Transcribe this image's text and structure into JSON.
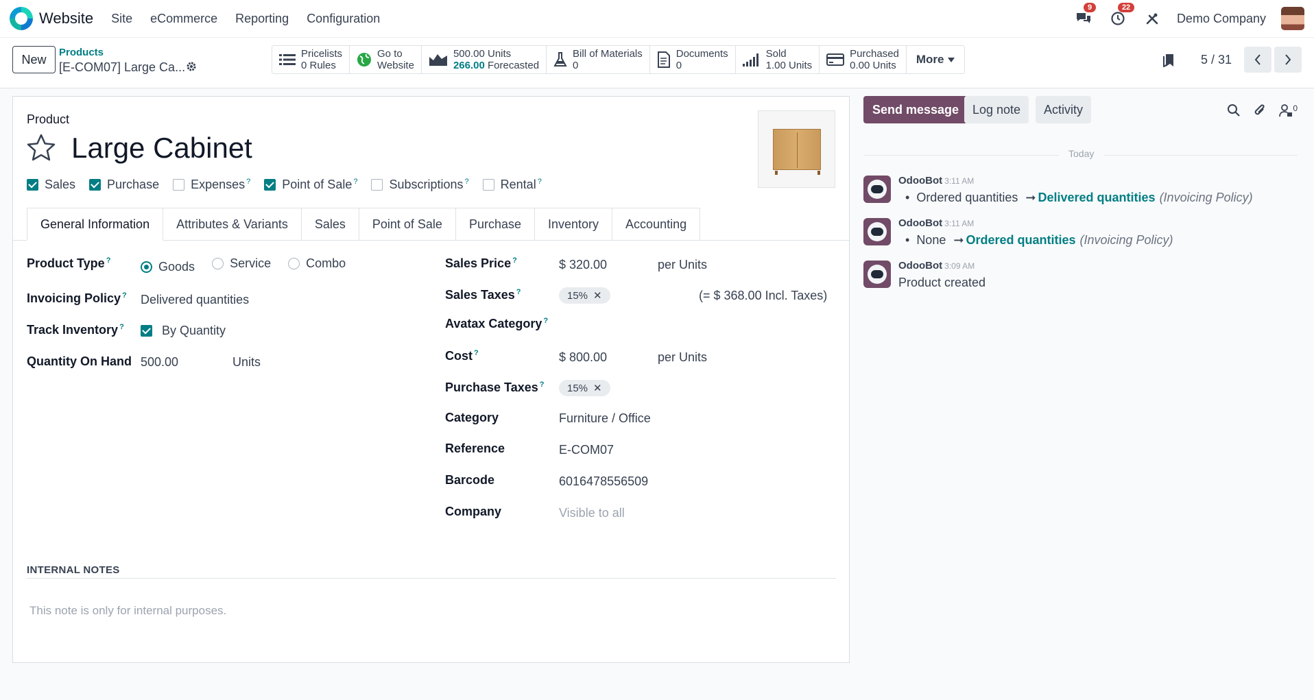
{
  "navbar": {
    "app_name": "Website",
    "menus": [
      "Site",
      "eCommerce",
      "Reporting",
      "Configuration"
    ],
    "messages_count": "9",
    "activities_count": "22",
    "company": "Demo Company"
  },
  "control": {
    "new_label": "New",
    "breadcrumb_parent": "Products",
    "breadcrumb_current": "[E-COM07] Large Ca...",
    "smart_buttons": [
      {
        "icon": "list-icon",
        "line1": "Pricelists",
        "line2": "0 Rules"
      },
      {
        "icon": "globe-icon",
        "line1": "Go to",
        "line2": "Website"
      },
      {
        "icon": "area-chart-icon",
        "line1": "500.00 Units",
        "line2_value": "266.00",
        "line2_suffix": "Forecasted"
      },
      {
        "icon": "flask-icon",
        "line1": "Bill of Materials",
        "line2": "0"
      },
      {
        "icon": "document-icon",
        "line1": "Documents",
        "line2": "0"
      },
      {
        "icon": "signal-bars-icon",
        "line1": "Sold",
        "line2": "1.00 Units"
      },
      {
        "icon": "credit-card-icon",
        "line1": "Purchased",
        "line2": "0.00 Units"
      }
    ],
    "more_label": "More",
    "pager": "5 / 31"
  },
  "product": {
    "section_label": "Product",
    "name": "Large Cabinet",
    "flags": [
      {
        "label": "Sales",
        "checked": true,
        "help": false
      },
      {
        "label": "Purchase",
        "checked": true,
        "help": false
      },
      {
        "label": "Expenses",
        "checked": false,
        "help": true
      },
      {
        "label": "Point of Sale",
        "checked": true,
        "help": true
      },
      {
        "label": "Subscriptions",
        "checked": false,
        "help": true
      },
      {
        "label": "Rental",
        "checked": false,
        "help": true
      }
    ],
    "tabs": [
      "General Information",
      "Attributes & Variants",
      "Sales",
      "Point of Sale",
      "Purchase",
      "Inventory",
      "Accounting"
    ],
    "left": {
      "product_type_label": "Product Type",
      "product_type_options": [
        "Goods",
        "Service",
        "Combo"
      ],
      "product_type_selected": "Goods",
      "invoicing_policy_label": "Invoicing Policy",
      "invoicing_policy_value": "Delivered quantities",
      "track_inventory_label": "Track Inventory",
      "track_inventory_value": "By Quantity",
      "qty_on_hand_label": "Quantity On Hand",
      "qty_on_hand_value": "500.00",
      "qty_on_hand_uom": "Units"
    },
    "right": {
      "sales_price_label": "Sales Price",
      "sales_price_value": "$ 320.00",
      "sales_price_uom": "per Units",
      "sales_taxes_label": "Sales Taxes",
      "sales_taxes_tag": "15%",
      "sales_taxes_incl": "(= $ 368.00 Incl. Taxes)",
      "avatax_label": "Avatax Category",
      "cost_label": "Cost",
      "cost_value": "$ 800.00",
      "cost_uom": "per Units",
      "purchase_taxes_label": "Purchase Taxes",
      "purchase_taxes_tag": "15%",
      "category_label": "Category",
      "category_value": "Furniture / Office",
      "reference_label": "Reference",
      "reference_value": "E-COM07",
      "barcode_label": "Barcode",
      "barcode_value": "6016478556509",
      "company_label": "Company",
      "company_placeholder": "Visible to all"
    },
    "notes_title": "INTERNAL NOTES",
    "notes_placeholder": "This note is only for internal purposes."
  },
  "chatter": {
    "send_message": "Send message",
    "log_note": "Log note",
    "activity": "Activity",
    "followers_count": "0",
    "date_separator": "Today",
    "messages": [
      {
        "author": "OdooBot",
        "time": "3:11 AM",
        "type": "change",
        "old": "Ordered quantities",
        "new": "Delivered quantities",
        "field": "(Invoicing Policy)"
      },
      {
        "author": "OdooBot",
        "time": "3:11 AM",
        "type": "change",
        "old": "None",
        "new": "Ordered quantities",
        "field": "(Invoicing Policy)"
      },
      {
        "author": "OdooBot",
        "time": "3:09 AM",
        "type": "text",
        "text": "Product created"
      }
    ]
  },
  "colors": {
    "accent": "#017e84",
    "primary": "#714b67",
    "badge": "#d23f3a"
  }
}
